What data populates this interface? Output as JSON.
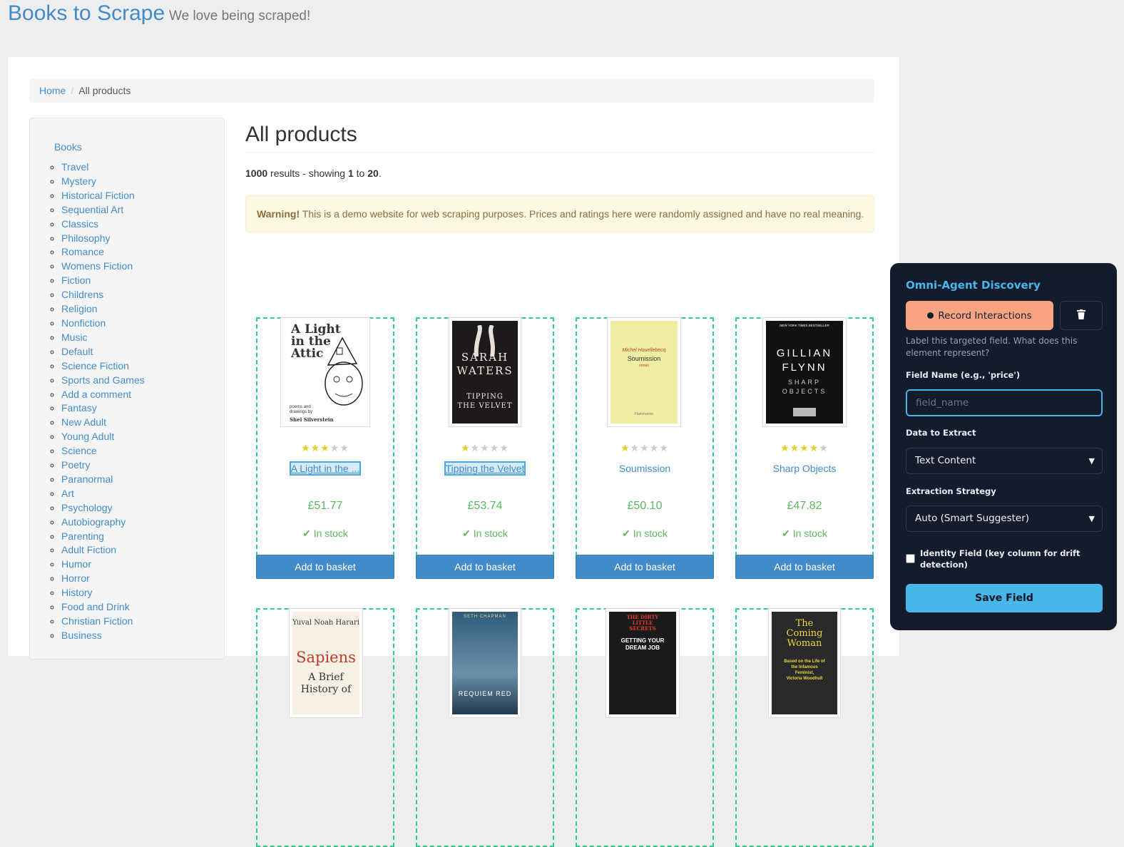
{
  "site": {
    "brand": "Books to Scrape",
    "tagline": "We love being scraped!"
  },
  "breadcrumb": {
    "home": "Home",
    "sep": "/",
    "current": "All products"
  },
  "sidebar": {
    "root": "Books",
    "categories": [
      "Travel",
      "Mystery",
      "Historical Fiction",
      "Sequential Art",
      "Classics",
      "Philosophy",
      "Romance",
      "Womens Fiction",
      "Fiction",
      "Childrens",
      "Religion",
      "Nonfiction",
      "Music",
      "Default",
      "Science Fiction",
      "Sports and Games",
      "Add a comment",
      "Fantasy",
      "New Adult",
      "Young Adult",
      "Science",
      "Poetry",
      "Paranormal",
      "Art",
      "Psychology",
      "Autobiography",
      "Parenting",
      "Adult Fiction",
      "Humor",
      "Horror",
      "History",
      "Food and Drink",
      "Christian Fiction",
      "Business"
    ]
  },
  "main": {
    "title": "All products",
    "results": {
      "total": "1000",
      "text1": " results - showing ",
      "from": "1",
      "text2": " to ",
      "to": "20",
      "text3": "."
    },
    "warning": {
      "strong": "Warning!",
      "text": " This is a demo website for web scraping purposes. Prices and ratings here were randomly assigned and have no real meaning."
    }
  },
  "products": [
    {
      "title": "A Light in the ...",
      "rating": 3,
      "price": "£51.77",
      "stock": "In stock",
      "button": "Add to basket",
      "cover_lines": [
        "A Light",
        "in the",
        "Attic"
      ],
      "cover_small": "poems and drawings by",
      "cover_author": "Shel Silverstein"
    },
    {
      "title": "Tipping the Velvet",
      "rating": 1,
      "price": "£53.74",
      "stock": "In stock",
      "button": "Add to basket",
      "cover_lines": [
        "SARAH",
        "WATERS"
      ],
      "cover_sub": [
        "TIPPING",
        "THE VELVET"
      ]
    },
    {
      "title": "Soumission",
      "rating": 1,
      "price": "£50.10",
      "stock": "In stock",
      "button": "Add to basket",
      "cover_author": "Michel Houellebecq",
      "cover_lines": [
        "Soumission"
      ],
      "cover_small": "roman",
      "cover_pub": "Flammarion"
    },
    {
      "title": "Sharp Objects",
      "rating": 4,
      "price": "£47.82",
      "stock": "In stock",
      "button": "Add to basket",
      "cover_top": "NEW YORK TIMES BESTSELLER",
      "cover_lines": [
        "GILLIAN",
        "FLYNN"
      ],
      "cover_sub": [
        "SHARP",
        "OBJECTS"
      ]
    }
  ],
  "products_row2": [
    {
      "cover_author": "Yuval Noah Harari",
      "cover_lines": [
        "Sapiens"
      ],
      "cover_sub": [
        "A Brief",
        "History of"
      ]
    },
    {
      "cover_author": "SETH CHAPMAN",
      "cover_sub": [
        "REQUIEM RED"
      ]
    },
    {
      "cover_lines": [
        "THE DIRTY",
        "LITTLE",
        "SECRETS"
      ],
      "cover_sub": [
        "GETTING YOUR",
        "DREAM JOB"
      ]
    },
    {
      "cover_lines": [
        "The",
        "Coming",
        "Woman"
      ],
      "cover_sub": [
        "Based on the Life of",
        "the Infamous",
        "Feminist,",
        "Victoria Woodhull"
      ]
    }
  ],
  "panel": {
    "title": "Omni-Agent Discovery",
    "record": "Record Interactions",
    "help": "Label this targeted field. What does this element represent?",
    "field_label": "Field Name (e.g., 'price')",
    "field_placeholder": "field_name",
    "extract_label": "Data to Extract",
    "extract_value": "Text Content",
    "strategy_label": "Extraction Strategy",
    "strategy_value": "Auto (Smart Suggester)",
    "identity": "Identity Field (key column for drift detection)",
    "save": "Save Field",
    "colors": {
      "accent": "#47b6e8",
      "record": "#f8a481",
      "bg": "#141b2d"
    }
  }
}
